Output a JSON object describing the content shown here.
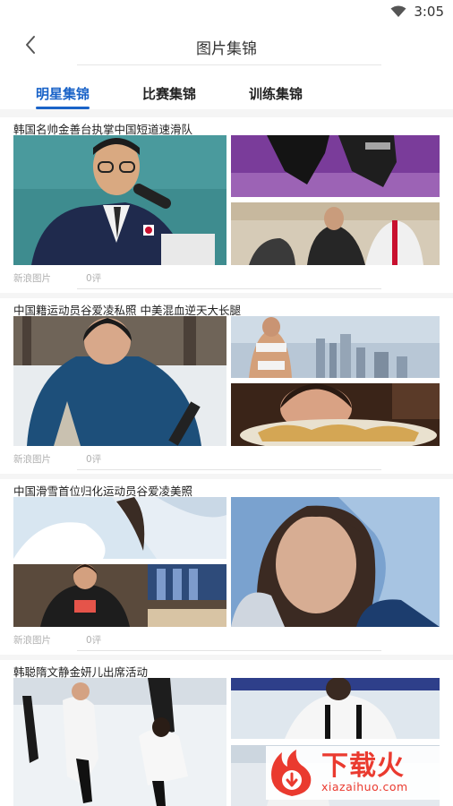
{
  "status": {
    "time": "3:05"
  },
  "header": {
    "title": "图片集锦"
  },
  "tabs": [
    {
      "label": "明星集锦",
      "active": true
    },
    {
      "label": "比赛集锦",
      "active": false
    },
    {
      "label": "训练集锦",
      "active": false
    }
  ],
  "cards": [
    {
      "title": "韩国名帅金善台执掌中国短道速滑队",
      "source": "新浪图片",
      "comments": "0评"
    },
    {
      "title": "中国籍运动员谷爱凌私照 中美混血逆天大长腿",
      "source": "新浪图片",
      "comments": "0评"
    },
    {
      "title": "中国滑雪首位归化运动员谷爱凌美照",
      "source": "新浪图片",
      "comments": "0评"
    },
    {
      "title": "韩聪隋文静金妍儿出席活动"
    }
  ],
  "watermark": {
    "text": "下载火",
    "url": "xiazaihuo.com"
  },
  "colors": {
    "accent": "#1a63c8",
    "watermark": "#ea3a2f"
  }
}
